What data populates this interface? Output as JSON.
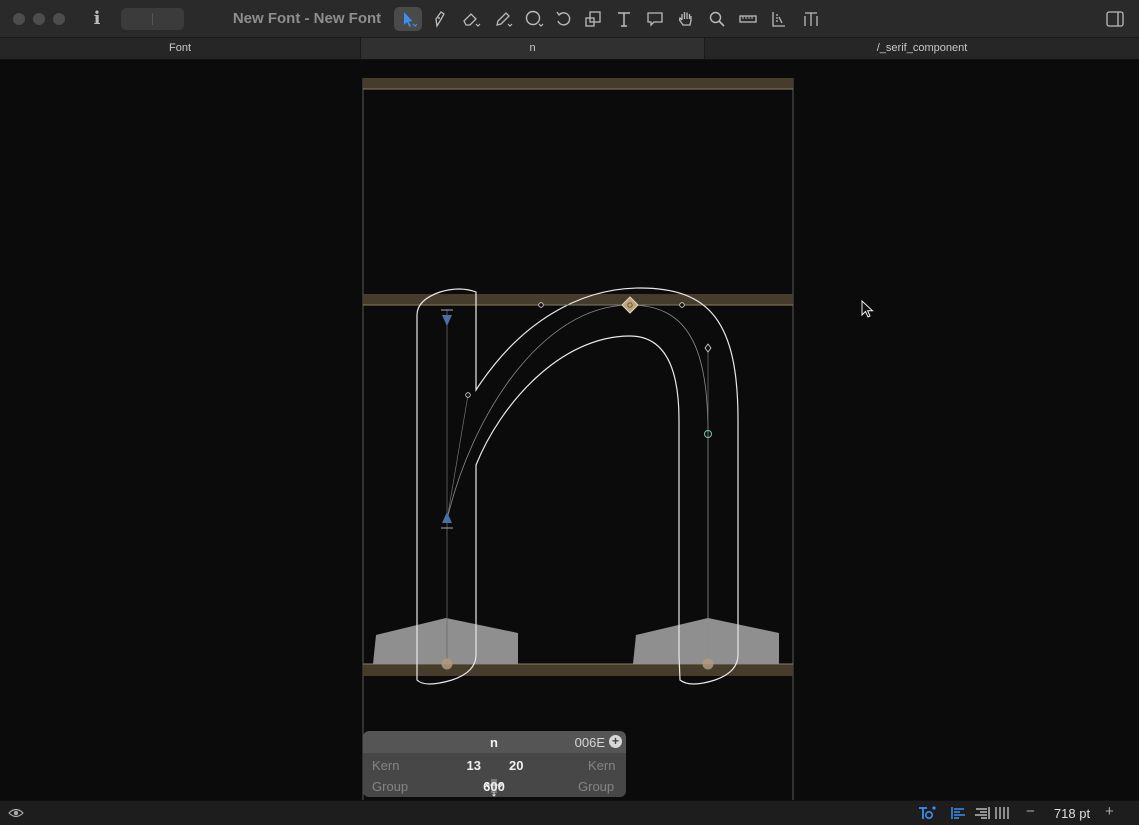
{
  "window": {
    "title": "New Font - New Font"
  },
  "toolbar": {
    "info_icon": "info-icon",
    "tools": [
      {
        "name": "select-tool",
        "icon": "arrow-pointer-icon",
        "active": true
      },
      {
        "name": "draw-tool",
        "icon": "pen-nib-icon"
      },
      {
        "name": "eraser-tool",
        "icon": "eraser-icon"
      },
      {
        "name": "pencil-tool",
        "icon": "pencil-icon"
      },
      {
        "name": "shape-tool",
        "icon": "circle-shape-icon"
      },
      {
        "name": "rotate-tool",
        "icon": "rotate-icon"
      },
      {
        "name": "scale-tool",
        "icon": "scale-icon"
      },
      {
        "name": "text-tool",
        "icon": "text-t-icon"
      },
      {
        "name": "annotation-tool",
        "icon": "speech-bubble-icon"
      },
      {
        "name": "hand-tool",
        "icon": "hand-icon"
      },
      {
        "name": "zoom-tool",
        "icon": "magnifier-icon"
      },
      {
        "name": "measure-tool",
        "icon": "ruler-icon"
      },
      {
        "name": "anchor-tool",
        "icon": "anchor-ruler-icon"
      },
      {
        "name": "metrics-tool",
        "icon": "metrics-t-icon"
      }
    ],
    "accent_color": "#3d8ef0"
  },
  "tabs": [
    {
      "label": "Font",
      "active": false
    },
    {
      "label": "n",
      "active": true
    },
    {
      "label": "/_serif_component",
      "active": false
    }
  ],
  "glyph_info": {
    "name": "n",
    "unicode": "006E",
    "left_label": "Kern",
    "right_label": "Kern",
    "left_kern": "13",
    "right_kern": "20",
    "group_label_left": "Group",
    "group_label_right": "Group",
    "width": "600"
  },
  "statusbar": {
    "zoom": "718 pt",
    "minus": "−",
    "plus": "+"
  },
  "colors": {
    "metric_band": "#463c2c",
    "outline": "#e8e8e8",
    "component_fill": "#8f8f8f",
    "node_selected": "#b8a57c"
  }
}
